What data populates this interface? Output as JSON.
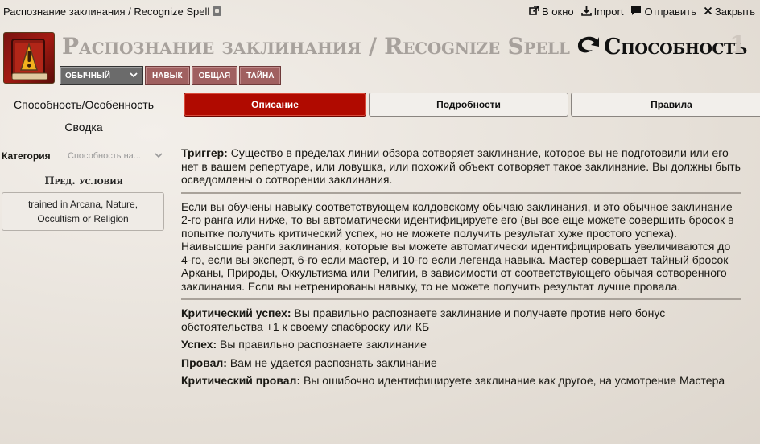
{
  "window": {
    "title": "Распознание заклинания / Recognize Spell",
    "actions": [
      {
        "icon": "external-window-icon",
        "label": "В окно"
      },
      {
        "icon": "download-icon",
        "label": "Import"
      },
      {
        "icon": "comment-icon",
        "label": "Отправить"
      },
      {
        "icon": "close-icon",
        "label": "Закрыть"
      }
    ]
  },
  "header": {
    "name": "Распознание заклинания / Recognize Spell",
    "action_type": "Способность",
    "level": "1",
    "rarity": "Обычный",
    "traits": [
      "Навык",
      "Общая",
      "Тайна"
    ]
  },
  "sidebar": {
    "type_label": "Способность/Особенность",
    "tab_label": "Сводка",
    "category_label": "Категория",
    "category_placeholder": "Способность на...",
    "prereq_title": "Пред. условия",
    "prereq_value": "trained in Arcana, Nature, Occultism or Religion"
  },
  "tabs": [
    {
      "label": "Описание",
      "active": true
    },
    {
      "label": "Подробности",
      "active": false
    },
    {
      "label": "Правила",
      "active": false
    }
  ],
  "description": {
    "trigger_label": "Триггер:",
    "trigger_text": " Существо в пределах линии обзора сотворяет заклинание, которое вы не подготовили или его нет в вашем репертуаре, или ловушка, или похожий объект сотворяет такое заклинание. Вы должны быть осведомлены о сотворении заклинания.",
    "main_text": "Если вы обучены навыку соответствующем колдовскому обычаю заклинания, и это обычное заклинание 2-го ранга или ниже, то вы автоматически идентифицируете его (вы все еще можете совершить бросок в попытке получить критический успех, но не можете получить результат хуже простого успеха). Наивысшие ранги заклинания, которые вы можете автоматически идентифицировать увеличиваются до 4-го, если вы эксперт, 6-го если мастер, и 10-го если легенда навыка. Мастер совершает тайный бросок Арканы, Природы, Оккультизма или Религии, в зависимости от соответствующего обычая сотворенного заклинания. Если вы нетренированы навыку, то не можете получить результат лучше провала.",
    "outcomes": [
      {
        "label": "Критический успех:",
        "text": " Вы правильно распознаете заклинание и получаете против него бонус обстоятельства +1 к своему спасброску или КБ"
      },
      {
        "label": "Успех:",
        "text": " Вы правильно распознаете заклинание"
      },
      {
        "label": "Провал:",
        "text": " Вам не удается распознать заклинание"
      },
      {
        "label": "Критический провал:",
        "text": " Вы ошибочно идентифицируете заклинание как другое, на усмотрение Мастера"
      }
    ]
  },
  "colors": {
    "active_tab": "#b00a00",
    "trait_tag": "#a06060",
    "rarity": "#6b6b6b"
  }
}
